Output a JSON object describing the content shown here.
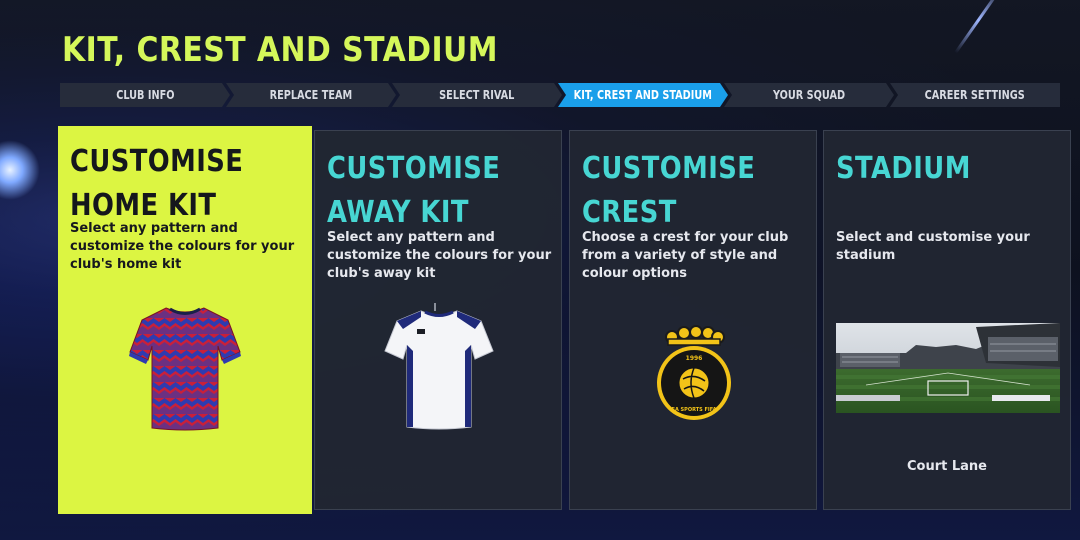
{
  "page": {
    "title": "KIT, CREST AND STADIUM"
  },
  "steps": [
    {
      "label": "CLUB INFO",
      "active": false
    },
    {
      "label": "REPLACE TEAM",
      "active": false
    },
    {
      "label": "SELECT RIVAL",
      "active": false
    },
    {
      "label": "KIT, CREST AND STADIUM",
      "active": true
    },
    {
      "label": "YOUR SQUAD",
      "active": false
    },
    {
      "label": "CAREER SETTINGS",
      "active": false
    }
  ],
  "cards": [
    {
      "title": "CUSTOMISE HOME KIT",
      "description": "Select any pattern and customize the colours for your club's home kit",
      "visual": "home-kit-shirt",
      "active": true
    },
    {
      "title": "CUSTOMISE AWAY KIT",
      "description": "Select any pattern and customize the colours for your club's away kit",
      "visual": "away-kit-shirt",
      "active": false
    },
    {
      "title": "CUSTOMISE CREST",
      "description": "Choose a crest for your club from a variety of style and colour options",
      "visual": "club-crest",
      "crest_year": "1996",
      "crest_text": "EA SPORTS FIFA",
      "active": false
    },
    {
      "title": "STADIUM",
      "description": "Select and customise your stadium",
      "visual": "stadium-image",
      "caption": "Court Lane",
      "active": false
    }
  ],
  "colors": {
    "accent_lime": "#dcf542",
    "title_lime": "#d5f75a",
    "step_active": "#1a9fea",
    "card_title_cyan": "#47d6d3",
    "card_bg": "#212632"
  }
}
